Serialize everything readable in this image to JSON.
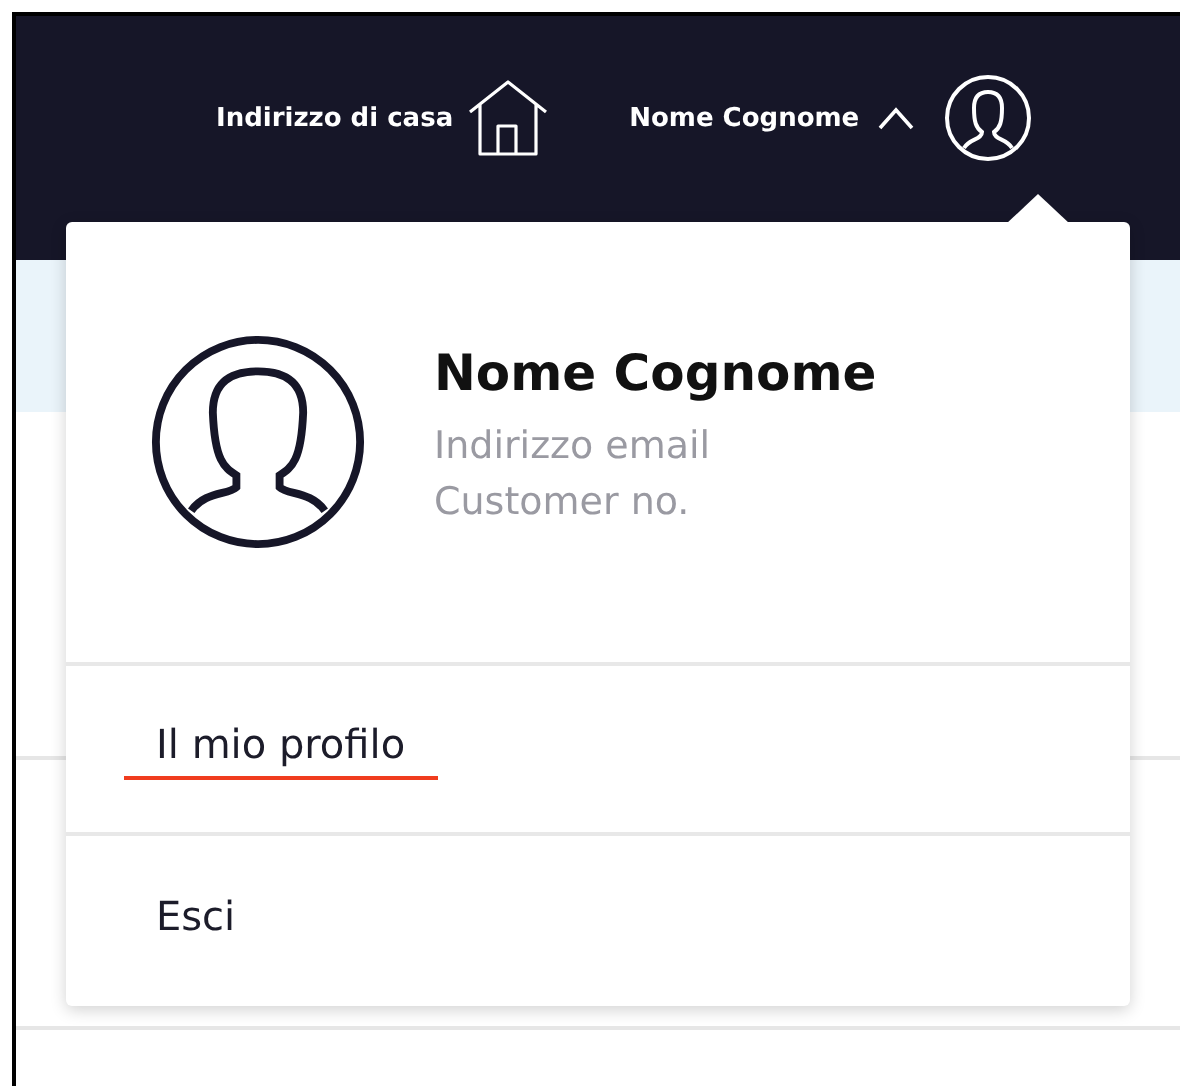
{
  "header": {
    "address": "Indirizzo di casa",
    "user_name": "Nome Cognome",
    "menu_expanded": true
  },
  "profile": {
    "name": "Nome Cognome",
    "email": "Indirizzo email",
    "customer_no": "Customer no."
  },
  "menu_items": [
    {
      "label": "Il mio profilo",
      "selected": true
    },
    {
      "label": "Esci",
      "selected": false
    }
  ]
}
